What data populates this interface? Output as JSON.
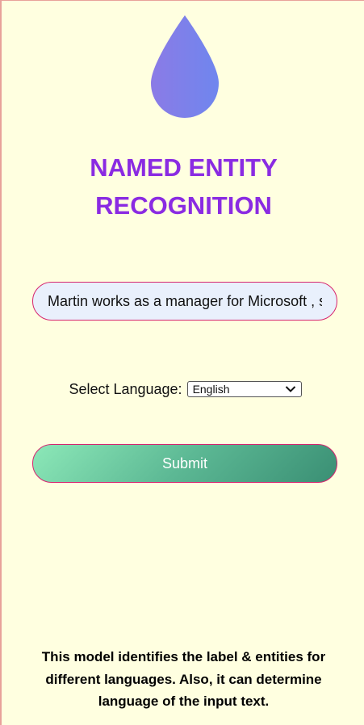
{
  "logo": {
    "icon": "water-drop-icon",
    "gradient_start": "#8b7be6",
    "gradient_end": "#6f86ee"
  },
  "title": {
    "line1": "NAMED ENTITY",
    "line2": "RECOGNITION",
    "color": "#8a2be2"
  },
  "text_input": {
    "value": "Martin works as a manager for Microsoft , s"
  },
  "language": {
    "label": "Select Language:",
    "selected": "English"
  },
  "submit": {
    "label": "Submit"
  },
  "footer": {
    "line1": "This model identifies the label & entities for",
    "line2": "different languages. Also, it can determine",
    "line3": "language of the input text."
  }
}
